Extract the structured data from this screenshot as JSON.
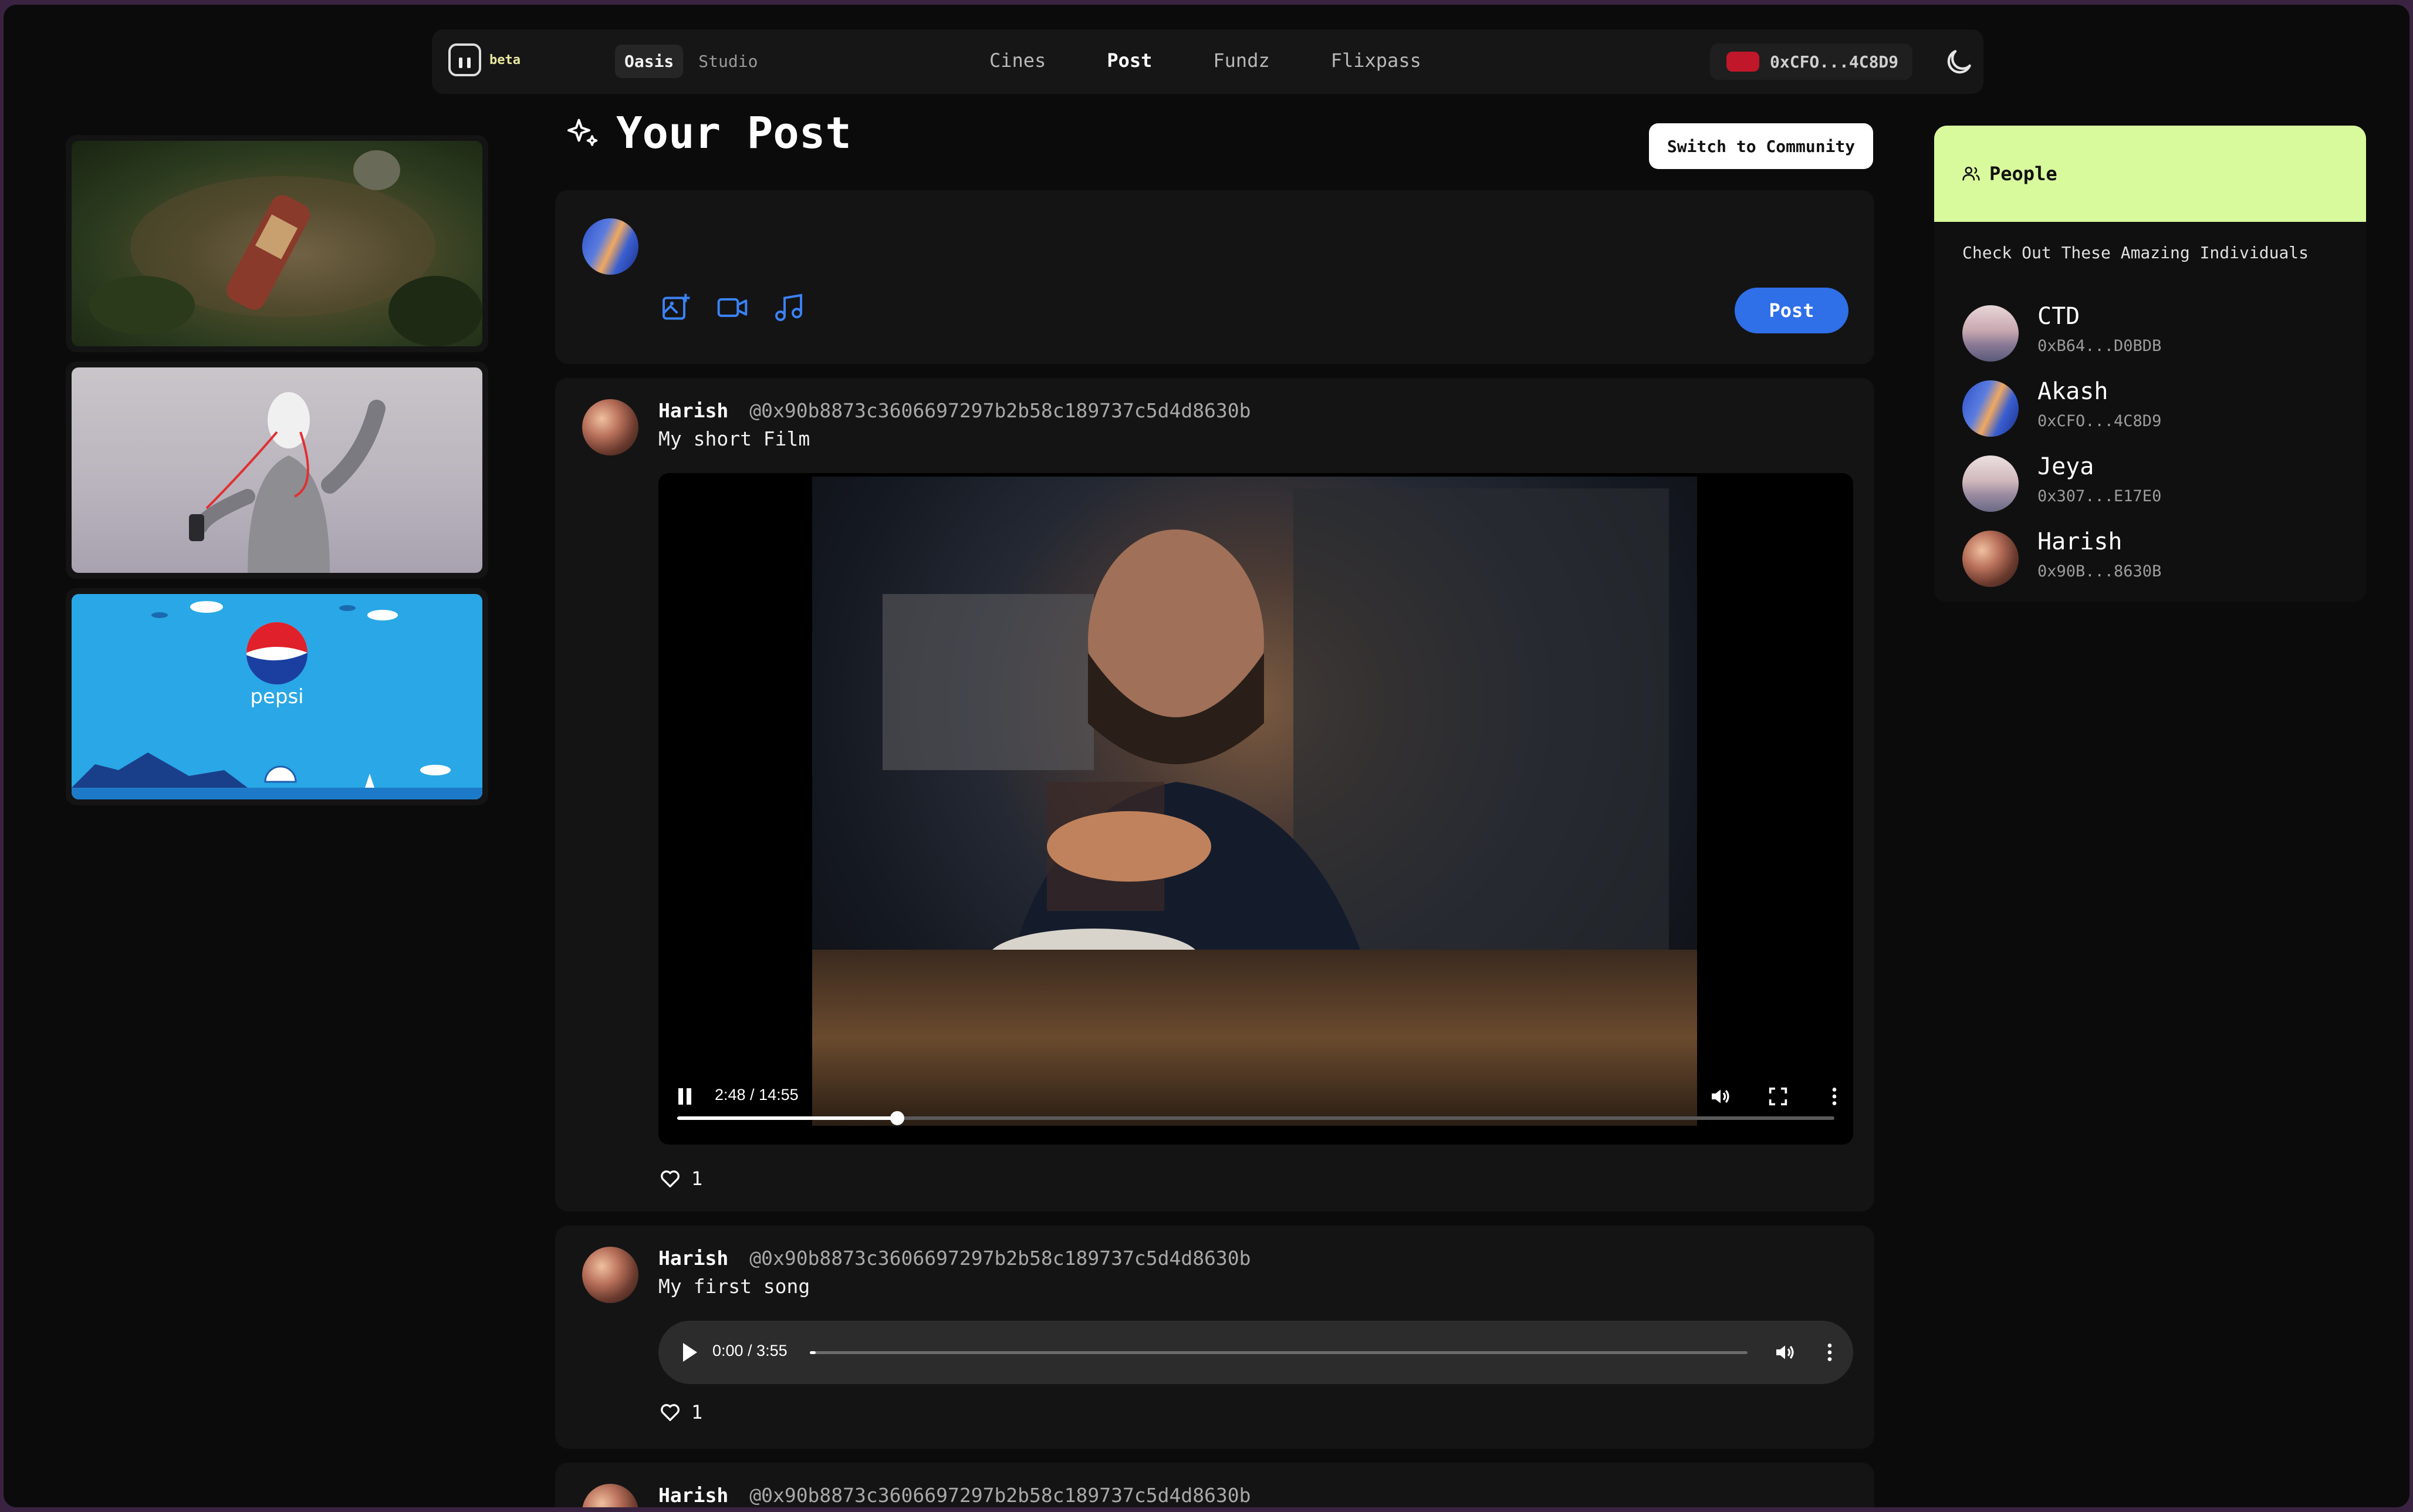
{
  "nav": {
    "beta_label": "beta",
    "toggle": [
      "Oasis",
      "Studio"
    ],
    "links": [
      "Cines",
      "Post",
      "Fundz",
      "Flixpass"
    ],
    "active_link": "Post",
    "wallet": "0xCFO...4C8D9"
  },
  "left_column": {
    "thumbnails": [
      {
        "icon": "can-in-forest-image"
      },
      {
        "icon": "character-with-earphones-image"
      },
      {
        "icon": "pepsi-beach-image",
        "brand_text": "pepsi"
      }
    ]
  },
  "page": {
    "title": "Your Post",
    "switch_button": "Switch to Community"
  },
  "composer": {
    "tools": [
      "image-plus-icon",
      "video-icon",
      "music-note-icon"
    ],
    "post_button": "Post"
  },
  "posts": [
    {
      "author": "Harish",
      "handle": "@0x90b8873c3606697297b2b58c189737c5d4d8630b",
      "text": "My short Film",
      "media": "video",
      "time": "2:48 / 14:55",
      "progress": 0.19,
      "likes": "1"
    },
    {
      "author": "Harish",
      "handle": "@0x90b8873c3606697297b2b58c189737c5d4d8630b",
      "text": "My first song",
      "media": "audio",
      "time": "0:00 / 3:55",
      "progress": 0.0,
      "likes": "1"
    },
    {
      "author": "Harish",
      "handle": "@0x90b8873c3606697297b2b58c189737c5d4d8630b"
    }
  ],
  "people": {
    "title": "People",
    "subtitle": "Check Out These Amazing Individuals",
    "list": [
      {
        "name": "CTD",
        "wallet": "0xB64...D0BDB"
      },
      {
        "name": "Akash",
        "wallet": "0xCFO...4C8D9"
      },
      {
        "name": "Jeya",
        "wallet": "0x307...E17E0"
      },
      {
        "name": "Harish",
        "wallet": "0x90B...8630B"
      }
    ]
  },
  "colors": {
    "accent": "#2f6fe8",
    "people_header": "#d9f99d",
    "wallet_badge": "#c0182a"
  }
}
